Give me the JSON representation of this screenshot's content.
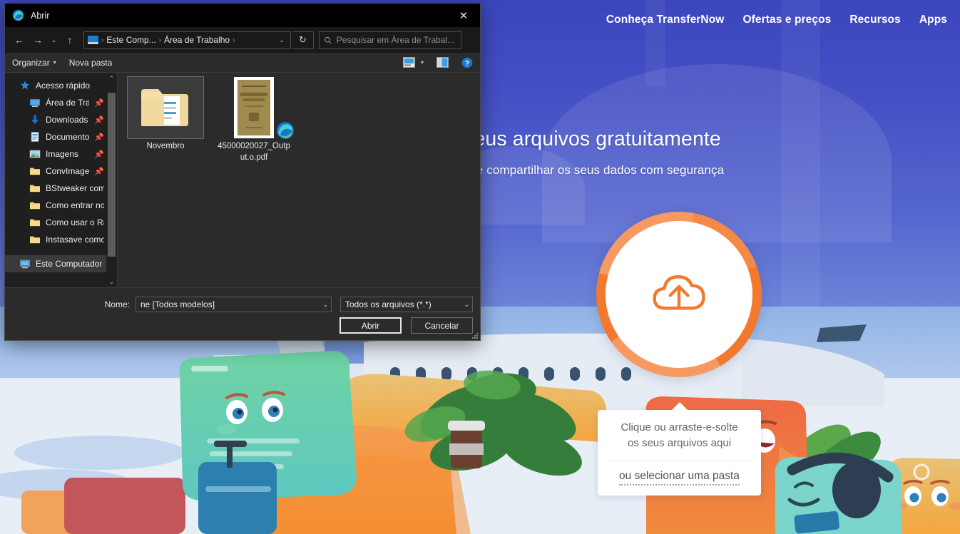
{
  "page": {
    "nav_links": [
      {
        "label": "Conheça TransferNow"
      },
      {
        "label": "Ofertas e preços"
      },
      {
        "label": "Recursos"
      },
      {
        "label": "Apps"
      }
    ],
    "hero": {
      "headline": "Transfira e despache os seus arquivos gratuitamente",
      "subheadline": "TransferNow é um meio simples e gratuito de compartilhar os seus dados com segurança"
    },
    "upload": {
      "icon": "cloud-upload-icon",
      "ring_color": "#f2792e",
      "ring_light_color": "#f79a62"
    },
    "callout": {
      "line1": "Clique ou arraste-e-solte",
      "line2": "os seus arquivos aqui",
      "link": "ou selecionar uma pasta"
    }
  },
  "dialog": {
    "title": "Abrir",
    "title_icon": "edge-browser-icon",
    "close_icon": "close-icon",
    "nav": {
      "back_icon": "arrow-left-icon",
      "forward_icon": "arrow-right-icon",
      "recent_icon": "chevron-down-icon",
      "up_icon": "arrow-up-icon",
      "refresh_icon": "refresh-icon",
      "breadcrumb_dropdown_icon": "chevron-down-icon",
      "breadcrumbs": [
        {
          "label": "Este Comp..."
        },
        {
          "label": "Área de Trabalho"
        }
      ]
    },
    "search": {
      "icon": "search-icon",
      "placeholder": "Pesquisar em Área de Trabal...",
      "value": ""
    },
    "toolbar": {
      "organize_label": "Organizar",
      "organize_caret": "▾",
      "new_folder_label": "Nova pasta",
      "view_icon": "view-layout-icon",
      "view_caret": "▾",
      "preview_pane_icon": "preview-pane-icon",
      "help_icon": "help-icon"
    },
    "sidebar": {
      "scroll_up_icon": "chevron-up-icon",
      "scroll_down_icon": "chevron-down-icon",
      "items": [
        {
          "label": "Acesso rápido",
          "icon": "star-pin-icon",
          "indent": false,
          "pinned": false,
          "selected": false
        },
        {
          "label": "Área de Traba",
          "icon": "desktop-icon",
          "indent": true,
          "pinned": true,
          "selected": false
        },
        {
          "label": "Downloads",
          "icon": "download-icon",
          "indent": true,
          "pinned": true,
          "selected": false
        },
        {
          "label": "Documentos",
          "icon": "documents-icon",
          "indent": true,
          "pinned": true,
          "selected": false
        },
        {
          "label": "Imagens",
          "icon": "pictures-icon",
          "indent": true,
          "pinned": true,
          "selected": false
        },
        {
          "label": "ConvImages",
          "icon": "folder-icon",
          "indent": true,
          "pinned": true,
          "selected": false
        },
        {
          "label": "BStweaker como",
          "icon": "folder-icon",
          "indent": true,
          "pinned": false,
          "selected": false
        },
        {
          "label": "Como entrar no",
          "icon": "folder-icon",
          "indent": true,
          "pinned": false,
          "selected": false
        },
        {
          "label": "Como usar o Rad",
          "icon": "folder-icon",
          "indent": true,
          "pinned": false,
          "selected": false
        },
        {
          "label": "Instasave como",
          "icon": "folder-icon",
          "indent": true,
          "pinned": false,
          "selected": false
        },
        {
          "label": "Este Computador",
          "icon": "this-pc-icon",
          "indent": false,
          "pinned": false,
          "selected": true
        }
      ]
    },
    "files": [
      {
        "name": "Novembro",
        "type": "folder",
        "selected": true
      },
      {
        "name": "45000020027_Output.o.pdf",
        "type": "pdf-thumbnail",
        "selected": false,
        "overlay_icon": "edge-browser-icon"
      }
    ],
    "footer": {
      "name_label": "Nome:",
      "name_value": "ne [Todos modelos]",
      "name_caret": "⌄",
      "filter_value": "Todos os arquivos (*.*)",
      "filter_caret": "⌄",
      "open_button": "Abrir",
      "cancel_button": "Cancelar",
      "resize_grip": "resize-grip-icon"
    }
  }
}
